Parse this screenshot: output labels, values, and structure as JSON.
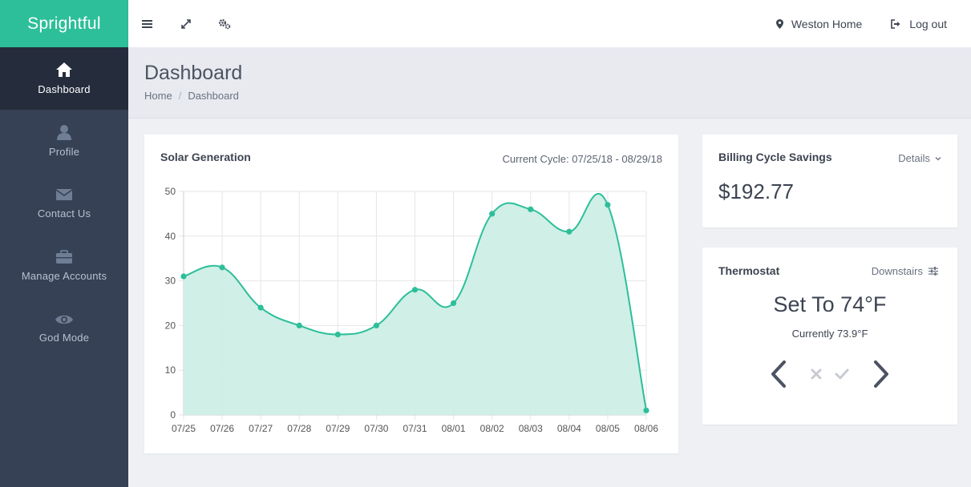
{
  "app": {
    "brand": "Sprightful"
  },
  "topbar": {
    "icons": [
      "menu-icon",
      "expand-icon",
      "gears-icon"
    ],
    "location_label": "Weston Home",
    "logout_label": "Log out"
  },
  "sidebar": {
    "items": [
      {
        "label": "Dashboard",
        "icon": "home-icon",
        "active": true
      },
      {
        "label": "Profile",
        "icon": "user-icon",
        "active": false
      },
      {
        "label": "Contact Us",
        "icon": "envelope-icon",
        "active": false
      },
      {
        "label": "Manage Accounts",
        "icon": "briefcase-icon",
        "active": false
      },
      {
        "label": "God Mode",
        "icon": "eye-icon",
        "active": false
      }
    ]
  },
  "header": {
    "title": "Dashboard",
    "breadcrumb": [
      "Home",
      "Dashboard"
    ]
  },
  "solar": {
    "title": "Solar Generation",
    "cycle_text": "Current Cycle:  07/25/18 - 08/29/18"
  },
  "billing": {
    "title": "Billing Cycle Savings",
    "details_label": "Details",
    "amount": "$192.77"
  },
  "thermostat": {
    "title": "Thermostat",
    "zone": "Downstairs",
    "set_to": "Set To 74°F",
    "current": "Currently 73.9°F"
  },
  "colors": {
    "accent": "#2dbf9a",
    "sidebar": "#364156",
    "sidebar_active": "#252d3d",
    "area_fill": "#cdeee6"
  },
  "chart_data": {
    "type": "area",
    "categories": [
      "07/25",
      "07/26",
      "07/27",
      "07/28",
      "07/29",
      "07/30",
      "07/31",
      "08/01",
      "08/02",
      "08/03",
      "08/04",
      "08/05",
      "08/06"
    ],
    "values": [
      31,
      33,
      24,
      20,
      18,
      20,
      28,
      25,
      45,
      46,
      41,
      47,
      1
    ],
    "ylim": [
      0,
      50
    ],
    "yticks": [
      0,
      10,
      20,
      30,
      40,
      50
    ],
    "grid": true
  }
}
